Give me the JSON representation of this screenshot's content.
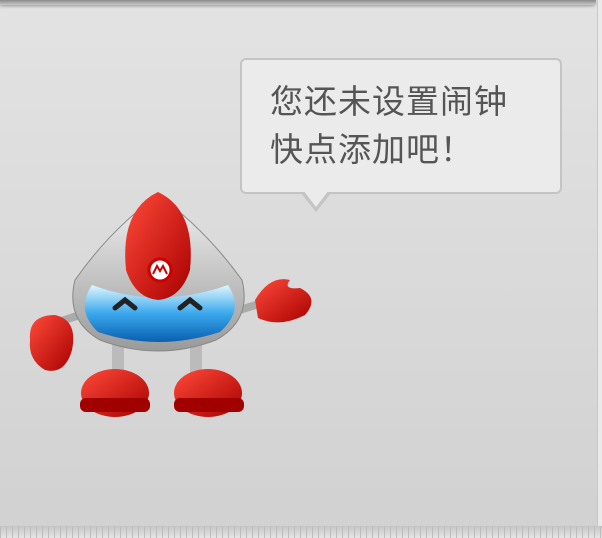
{
  "empty_state": {
    "message_line1": "您还未设置闹钟",
    "message_line2": "快点添加吧！",
    "mascot": "robot-mascot-icon",
    "accent_color": "#d40000"
  }
}
